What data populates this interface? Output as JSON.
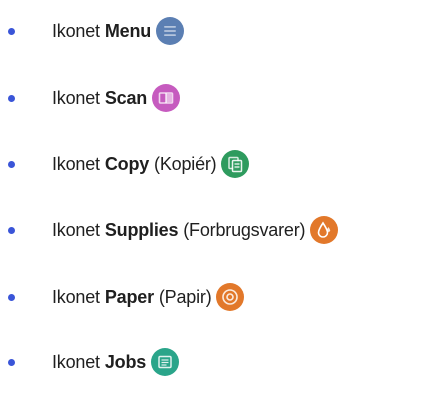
{
  "items": [
    {
      "prefix": "Ikonet",
      "name": "Menu",
      "paren": "",
      "icon": "menu-icon",
      "color": "#5b7fb3"
    },
    {
      "prefix": "Ikonet",
      "name": "Scan",
      "paren": "",
      "icon": "scan-icon",
      "color": "#c65bbf"
    },
    {
      "prefix": "Ikonet",
      "name": "Copy",
      "paren": "(Kopiér)",
      "icon": "copy-icon",
      "color": "#2e9b5e"
    },
    {
      "prefix": "Ikonet",
      "name": "Supplies",
      "paren": "(Forbrugsvarer)",
      "icon": "supplies-icon",
      "color": "#e2782a"
    },
    {
      "prefix": "Ikonet",
      "name": "Paper",
      "paren": "(Papir)",
      "icon": "paper-icon",
      "color": "#e2782a"
    },
    {
      "prefix": "Ikonet",
      "name": "Jobs",
      "paren": "",
      "icon": "jobs-icon",
      "color": "#2aa58a"
    }
  ]
}
